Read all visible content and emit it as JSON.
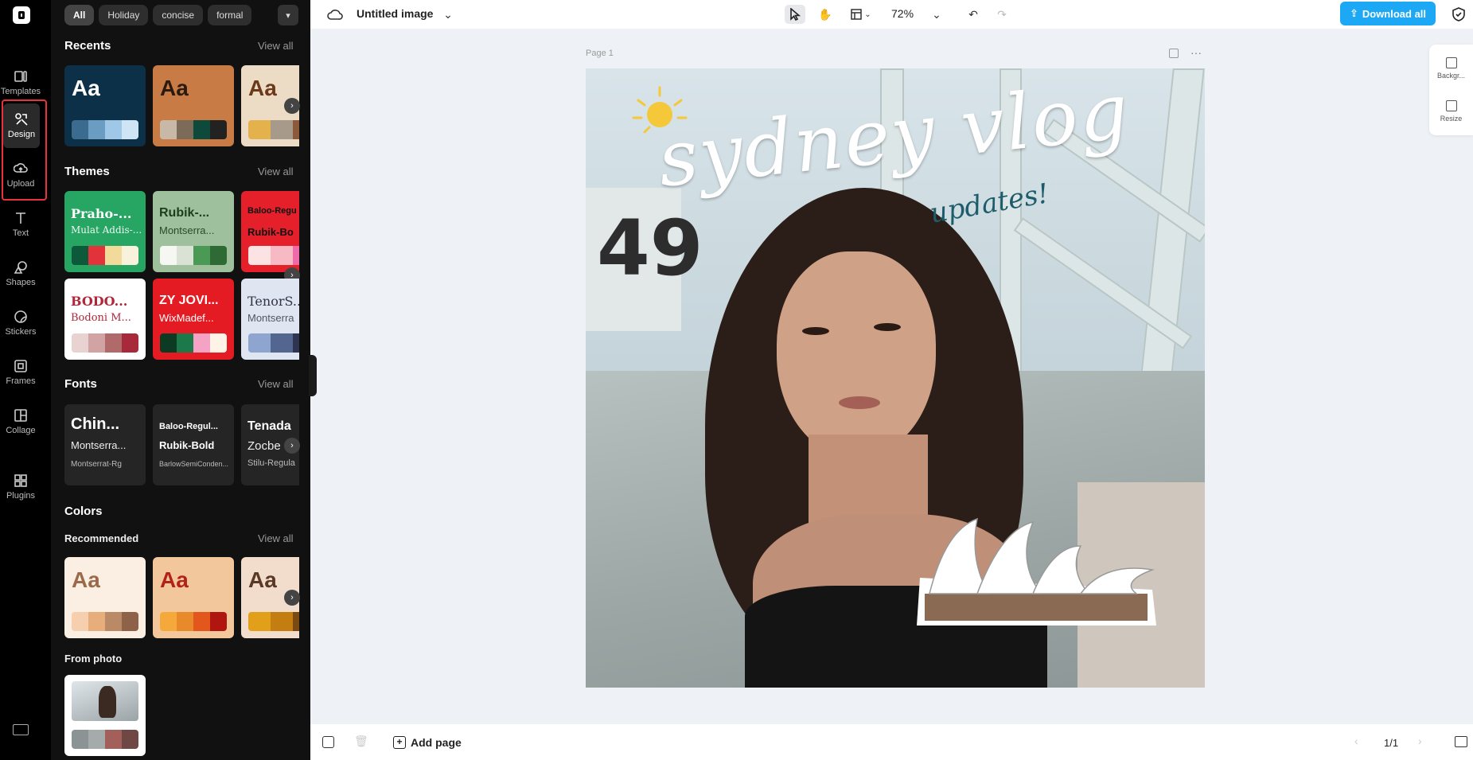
{
  "rail": {
    "items": [
      {
        "label": "Templates",
        "icon": "templates-icon"
      },
      {
        "label": "Design",
        "icon": "design-icon"
      },
      {
        "label": "Upload",
        "icon": "upload-icon"
      },
      {
        "label": "Text",
        "icon": "text-icon"
      },
      {
        "label": "Shapes",
        "icon": "shapes-icon"
      },
      {
        "label": "Stickers",
        "icon": "stickers-icon"
      },
      {
        "label": "Frames",
        "icon": "frames-icon"
      },
      {
        "label": "Collage",
        "icon": "collage-icon"
      },
      {
        "label": "Plugins",
        "icon": "plugins-icon"
      }
    ]
  },
  "panel": {
    "chips": [
      "All",
      "Holiday",
      "concise",
      "formal"
    ],
    "recents": {
      "title": "Recents",
      "view_all": "View all"
    },
    "themes": {
      "title": "Themes",
      "view_all": "View all",
      "cards": [
        {
          "t1": "Praho-...",
          "t2": "Mulat Addis-..."
        },
        {
          "t1": "Rubik-...",
          "t2": "Montserra..."
        },
        {
          "t1": "Baloo-Regu",
          "t2": "Rubik-Bo"
        },
        {
          "t1": "BODO...",
          "t2": "Bodoni M..."
        },
        {
          "t1": "ZY JOVI...",
          "t2": "WixMadef..."
        },
        {
          "t1": "TenorS...",
          "t2": "Montserra"
        }
      ]
    },
    "fonts": {
      "title": "Fonts",
      "view_all": "View all",
      "cards": [
        {
          "t1": "Chin...",
          "t2": "Montserra...",
          "t3": "Montserrat-Rg"
        },
        {
          "t1": "Baloo-Regul...",
          "t2": "Rubik-Bold",
          "t3": "BarlowSemiConden..."
        },
        {
          "t1": "Tenada",
          "t2": "Zocbe",
          "t3": "Stilu-Regula"
        }
      ]
    },
    "colors": {
      "title": "Colors",
      "recommended": "Recommended",
      "view_all": "View all"
    },
    "from_photo": "From photo",
    "aa": "Aa"
  },
  "topbar": {
    "doc_title": "Untitled image",
    "zoom": "72%",
    "download_label": "Download all"
  },
  "canvas": {
    "page_label": "Page 1",
    "headline": "sydney vlog",
    "subline": "updates!",
    "sign_number": "49"
  },
  "rightpanel": {
    "background": "Backgr...",
    "resize": "Resize"
  },
  "bottombar": {
    "add_page": "Add page",
    "page_count": "1/1"
  },
  "colors": {
    "accent": "#1ca8f5",
    "highlight": "#e8333c"
  }
}
